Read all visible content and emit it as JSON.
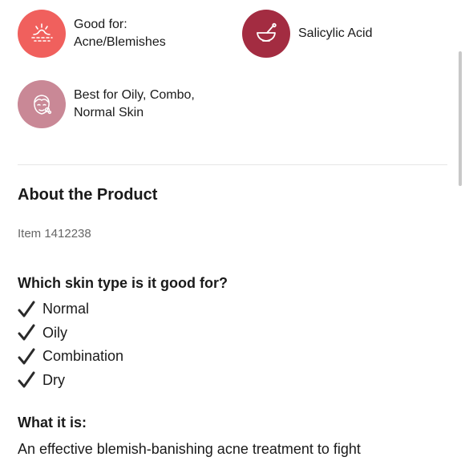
{
  "highlights": [
    {
      "line1": "Good for:",
      "line2": "Acne/Blemishes",
      "icon": "acne-icon",
      "color": "#f0605d"
    },
    {
      "line1": "Salicylic Acid",
      "icon": "mortar-pestle-icon",
      "color": "#a32c41"
    },
    {
      "line1": "Best for Oily, Combo,",
      "line2": "Normal Skin",
      "icon": "face-icon",
      "color": "#c98896"
    }
  ],
  "about": {
    "title": "About the Product",
    "item": "Item 1412238"
  },
  "skin_types": {
    "question": "Which skin type is it good for?",
    "items": [
      "Normal",
      "Oily",
      "Combination",
      "Dry"
    ],
    "check_icon": "checkmark-icon"
  },
  "what_it_is": {
    "title": "What it is:",
    "text": "An effective blemish-banishing acne treatment to fight"
  }
}
